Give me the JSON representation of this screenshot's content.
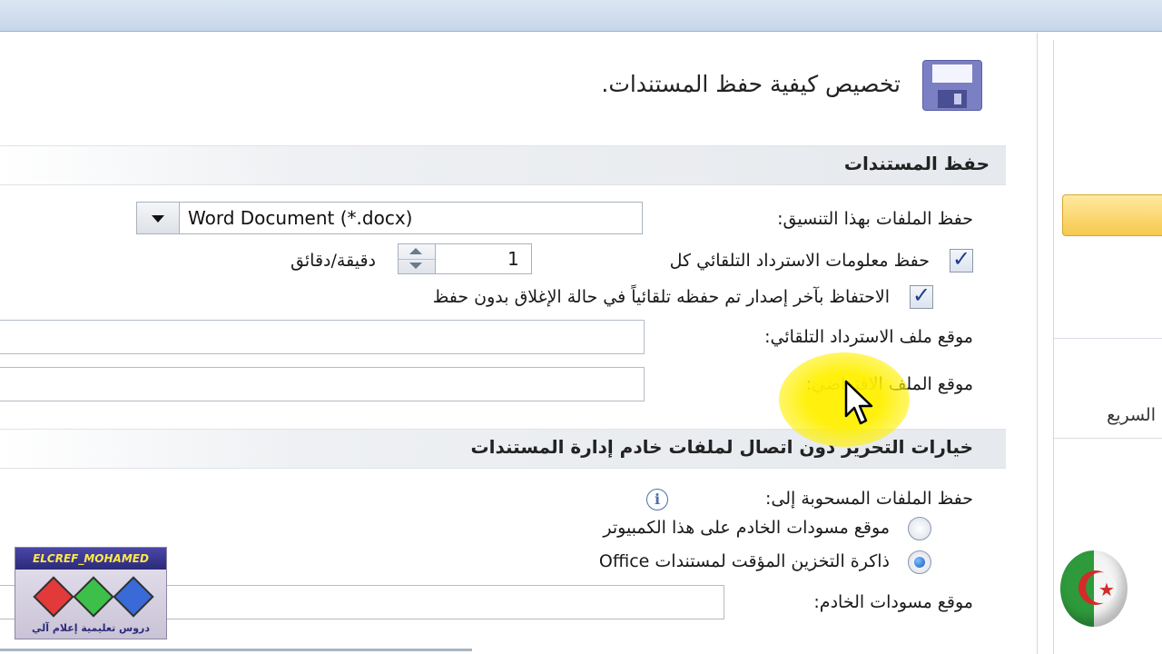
{
  "header": {
    "title": "تخصيص كيفية حفظ المستندات."
  },
  "sections": {
    "save_documents": "حفظ المستندات",
    "offline_editing": "خيارات التحرير دون اتصال لملفات خادم إدارة المستندات"
  },
  "save_format": {
    "label": "حفظ الملفات بهذا التنسيق:",
    "value": "Word Document (*.docx)"
  },
  "autorecover": {
    "checkbox_label": "حفظ معلومات الاسترداد التلقائي كل",
    "checked": true,
    "minutes_value": "1",
    "minutes_unit": "دقيقة/دقائق"
  },
  "keep_last": {
    "checkbox_label": "الاحتفاظ بآخر إصدار تم حفظه تلقائياً في حالة الإغلاق بدون حفظ",
    "checked": true
  },
  "autorecover_location": {
    "label": "موقع ملف الاسترداد التلقائي:",
    "value": ""
  },
  "default_location": {
    "label": "موقع الملف الافتراضي:",
    "value": ""
  },
  "offline": {
    "save_checked_out_label": "حفظ الملفات المسحوبة إلى:",
    "radio_server_drafts": "موقع مسودات الخادم على هذا الكمبيوتر",
    "radio_server_drafts_selected": false,
    "radio_office_cache": "ذاكرة التخزين المؤقت لمستندات Office",
    "radio_office_cache_selected": true,
    "server_drafts_location_label": "موقع مسودات الخادم:",
    "server_drafts_location_value": ""
  },
  "right_panel": {
    "partial_text": "السريع"
  },
  "watermark": {
    "top_text": "ELCREF_MOHAMED",
    "bottom_text": "دروس تعليمية إعلام آلي"
  },
  "colors": {
    "section_bar": "#e6e9ed",
    "highlight": "#fff000",
    "accent_button": "#f7c94d"
  }
}
